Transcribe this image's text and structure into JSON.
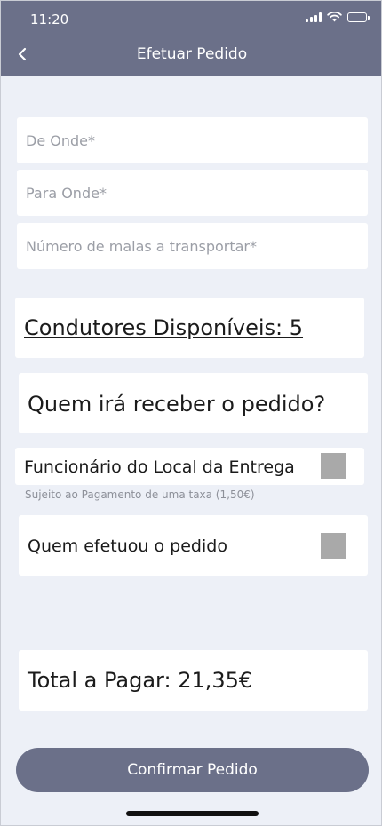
{
  "status_bar": {
    "time": "11:20",
    "icons": [
      "signal-icon",
      "wifi-icon",
      "battery-icon"
    ]
  },
  "header": {
    "title": "Efetuar Pedido",
    "back_icon": "chevron-left-icon"
  },
  "form": {
    "from_placeholder": "De Onde*",
    "to_placeholder": "Para Onde*",
    "bags_placeholder": "Número de malas a transportar*"
  },
  "drivers": {
    "text": "Condutores Disponíveis: 5"
  },
  "receiver": {
    "question": "Quem irá receber o pedido?",
    "options": [
      {
        "label": "Funcionário do Local da Entrega",
        "checked": false,
        "note": "Sujeito ao Pagamento de uma taxa (1,50€)"
      },
      {
        "label": "Quem efetuou o pedido",
        "checked": false
      }
    ]
  },
  "total": {
    "text": "Total a Pagar: 21,35€"
  },
  "confirm_button": {
    "label": "Confirmar Pedido"
  },
  "colors": {
    "header_bg": "#6b7089",
    "page_bg": "#edf0f7",
    "checkbox": "#a9a9a9"
  }
}
